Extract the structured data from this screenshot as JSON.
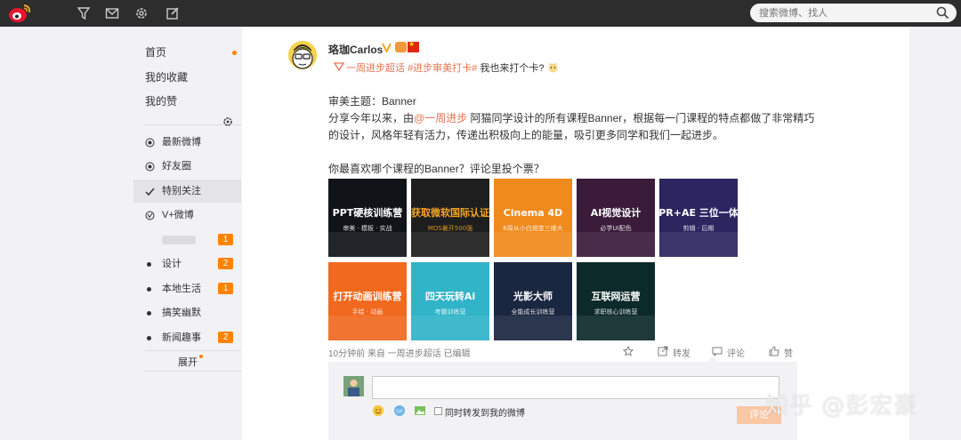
{
  "topbar": {
    "search_placeholder": "搜索微博、找人",
    "icons": [
      "weibo-logo",
      "filter-icon",
      "mail-icon",
      "gear-icon",
      "compose-icon",
      "search-icon"
    ]
  },
  "sidebar": {
    "items": [
      {
        "label": "首页",
        "dot": true
      },
      {
        "label": "我的收藏"
      },
      {
        "label": "我的赞"
      }
    ],
    "groups": [
      {
        "label": "最新微博",
        "icon": "radio-icon"
      },
      {
        "label": "好友圈",
        "icon": "radio-icon"
      },
      {
        "label": "特别关注",
        "icon": "check-icon",
        "active": true
      },
      {
        "label": "V+微博",
        "icon": "vplus-icon"
      }
    ],
    "lists": [
      {
        "label": "",
        "badge": "1",
        "blurred": true
      },
      {
        "label": "设计",
        "badge": "2"
      },
      {
        "label": "本地生活",
        "badge": "1"
      },
      {
        "label": "搞笑幽默",
        "badge": ""
      },
      {
        "label": "新闻趣事",
        "badge": "2"
      }
    ],
    "expand_label": "展开"
  },
  "post": {
    "username": "珞珈Carlos",
    "tag_prefix": "",
    "tag_1": "一周进步超话",
    "tag_2": "#进步审美打卡#",
    "tag_suffix": " 我也来打个卡?",
    "line_1": "审美主题：Banner",
    "line_2_a": "分享今年以来，由",
    "line_2_mention": "@一周进步",
    "line_2_b": " 阿猫同学设计的所有课程Banner，根据每一门课程的特点都做了非常精巧",
    "line_3": "的设计，风格年轻有活力，传递出积极向上的能量，吸引更多同学和我们一起进步。",
    "line_5": "你最喜欢哪个课程的Banner？评论里投个票？",
    "thumbnails": [
      {
        "text": "PPT硬核训练营",
        "sub": "审美 · 模板 · 实战",
        "bg": "#101418",
        "fg": "#ffffff"
      },
      {
        "text": "获取微软国际认证",
        "sub": "MOS暑开500强",
        "bg": "#1e1e1e",
        "fg": "#f5a623"
      },
      {
        "text": "Cinema 4D",
        "sub": "8周从小白蜕变三维大",
        "bg": "#f08a1c",
        "fg": "#ffffff"
      },
      {
        "text": "AI视觉设计",
        "sub": "必学UI配色",
        "bg": "#3a1b3a",
        "fg": "#ffffff"
      },
      {
        "text": "PR+AE 三位一体",
        "sub": "剪辑 · 后期",
        "bg": "#2c2560",
        "fg": "#ffffff"
      },
      {
        "text": "打开动画训练营",
        "sub": "手绘 · 动画",
        "bg": "#f0691f",
        "fg": "#ffffff"
      },
      {
        "text": "四天玩转Ai",
        "sub": "考霸训练营",
        "bg": "#31b3c8",
        "fg": "#ffffff"
      },
      {
        "text": "光影大师",
        "sub": "全能成长训练营",
        "bg": "#1a2740",
        "fg": "#ffffff"
      },
      {
        "text": "互联网运营",
        "sub": "求职核心训练营",
        "bg": "#0d2a2a",
        "fg": "#ffffff"
      }
    ],
    "meta": "10分钟前 来自 一周进步超话 已编辑",
    "actions": {
      "favorite": "",
      "repost": "转发",
      "comment": "评论",
      "like": "赞"
    }
  },
  "comment_box": {
    "repost_label": "同时转发到我的微博",
    "submit_label": "评论"
  },
  "watermark": "知乎 @彭宏豪",
  "colors": {
    "accent": "#ff8200",
    "link": "#eb7350",
    "topbar": "#2d2d2d"
  }
}
